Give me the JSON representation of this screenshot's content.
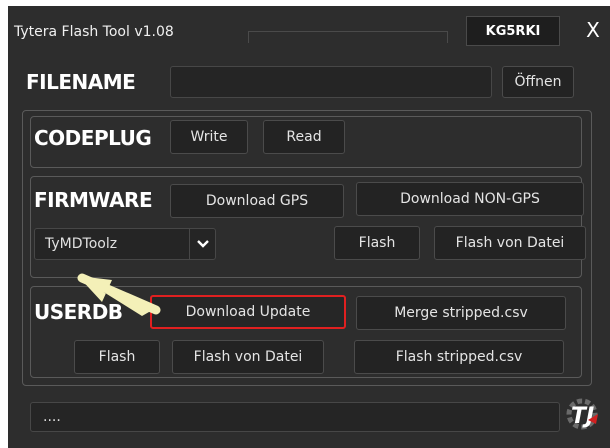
{
  "window": {
    "title": "Tytera Flash Tool  v1.08",
    "callsign": "KG5RKI",
    "close_label": "X"
  },
  "filename": {
    "label": "FILENAME",
    "value": "",
    "open_label": "Öffnen"
  },
  "codeplug": {
    "label": "CODEPLUG",
    "write_label": "Write",
    "read_label": "Read"
  },
  "firmware": {
    "label": "FIRMWARE",
    "download_gps_label": "Download GPS",
    "download_nongps_label": "Download NON-GPS",
    "tool_select_value": "TyMDToolz",
    "flash_label": "Flash",
    "flash_file_label": "Flash von Datei"
  },
  "userdb": {
    "label": "USERDB",
    "download_update_label": "Download Update",
    "merge_label": "Merge stripped.csv",
    "flash_label": "Flash",
    "flash_file_label": "Flash von Datei",
    "flash_stripped_label": "Flash stripped.csv"
  },
  "status": {
    "text": "...."
  },
  "colors": {
    "background": "#2d2d2d",
    "highlight_box": "#e02020",
    "arrow": "#f4f0b8"
  }
}
